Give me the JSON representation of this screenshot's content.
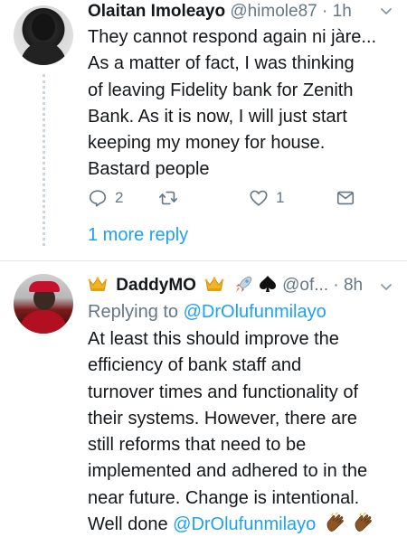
{
  "tweets": [
    {
      "name": "Olaitan Imoleayo",
      "handle": "@himole87",
      "dot": "·",
      "time": "1h",
      "lines": [
        "They cannot respond again ni jàre...",
        "As a matter of fact, I was thinking",
        "of leaving Fidelity bank for Zenith",
        "Bank. As it is now, I will just start",
        "keeping my money for house.",
        "Bastard people"
      ],
      "reply_count": "2",
      "retweet_count": "",
      "like_count": "1",
      "more_replies": "1 more reply"
    },
    {
      "name": "DaddyMO",
      "handle": "@of...",
      "dot": "·",
      "time": "8h",
      "replying_label": "Replying to",
      "replying_to": "@DrOlufunmilayo",
      "lines": [
        "At least this should improve the",
        "efficiency of bank staff and",
        "turnover times and functionality of",
        "their systems. However, there are",
        "still reforms that need to be",
        "implemented and adhered to in the",
        "near future. Change is intentional."
      ],
      "last_line_prefix": "Well done",
      "last_line_mention": "@DrOlufunmilayo"
    }
  ],
  "icons": [
    "chevron-down-icon",
    "crown-icon",
    "rocket-icon",
    "spade-icon",
    "clap-icon",
    "reply-icon",
    "retweet-icon",
    "like-icon",
    "dm-icon"
  ],
  "colors": {
    "link": "#1da1f2",
    "muted": "#657786",
    "text": "#14171a",
    "divider": "#e1e8ed"
  }
}
